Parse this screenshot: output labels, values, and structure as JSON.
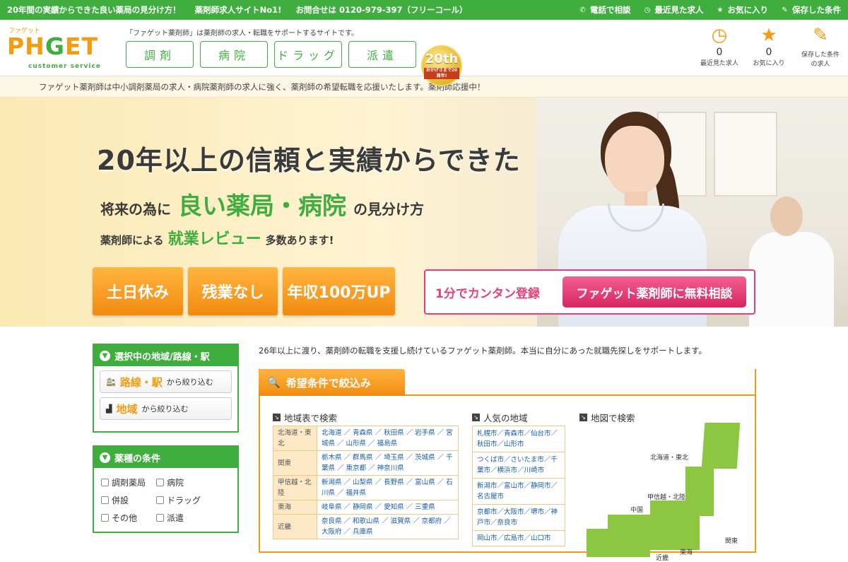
{
  "topbar": {
    "msg1": "20年間の実績からできた良い薬局の見分け方！",
    "msg2": "薬剤師求人サイトNo1!",
    "msg3": "お問合せは 0120-979-397（フリーコール）",
    "links": [
      {
        "icon": "phone-icon",
        "glyph": "✆",
        "label": "電話で相談"
      },
      {
        "icon": "clock-icon",
        "glyph": "◷",
        "label": "最近見た求人"
      },
      {
        "icon": "star-icon",
        "glyph": "★",
        "label": "お気に入り"
      },
      {
        "icon": "edit-icon",
        "glyph": "✎",
        "label": "保存した条件"
      }
    ]
  },
  "header": {
    "logo_kana": "ファゲット",
    "logo_text_1": "PH",
    "logo_text_g": "G",
    "logo_text_2": "ET",
    "logo_sub": "customer service",
    "tagline": "「ファゲット薬剤師」は薬剤師の求人・転職をサポートするサイトです。",
    "nav": [
      "調剤",
      "病院",
      "ドラッグ",
      "派遣"
    ],
    "badge_num": "20th",
    "badge_sub": "おかげさまで20周年!",
    "icons": [
      {
        "name": "recent",
        "glyph": "◷",
        "count": "0",
        "label": "最近見た求人"
      },
      {
        "name": "favorite",
        "glyph": "★",
        "count": "0",
        "label": "お気に入り"
      },
      {
        "name": "saved",
        "glyph": "✎",
        "count": "",
        "label": "保存した条件の求人"
      }
    ]
  },
  "subbar": "ファゲット薬剤師は中小調剤薬局の求人・病院薬剤師の求人に強く、薬剤師の希望転職を応援いたします。薬剤師応援中！",
  "hero": {
    "headline": "20年以上の信頼と実績からできた",
    "line2_pre": "将来の為に",
    "line2_big": "良い薬局・病院",
    "line2_post": "の見分け方",
    "line3_pre": "薬剤師による",
    "line3_big": "就業レビュー",
    "line3_post": "多数あります!",
    "features": [
      "土日休み",
      "残業なし",
      "年収100万UP"
    ],
    "cta_text": "1分でカンタン登録",
    "cta_button": "ファゲット薬剤師に無料相談"
  },
  "sidebar": {
    "area_title": "選択中の地域/路線・駅",
    "route_key": "路線・駅",
    "route_rest": "から絞り込む",
    "area_key": "地域",
    "area_rest": "から絞り込む",
    "type_title": "薬種の条件",
    "types": [
      "調剤薬局",
      "病院",
      "併設",
      "ドラッグ",
      "その他",
      "派遣"
    ]
  },
  "main": {
    "intro": "26年以上に渡り、薬剤師の転職を支援し続けているファゲット薬剤師。本当に自分にあった就職先探しをサポートします。",
    "filter_title": "希望条件で絞込み",
    "region_title": "地域表で検索",
    "popular_title": "人気の地域",
    "map_title": "地図で検索",
    "regions": [
      {
        "region": "北海道・東北",
        "prefs": "北海道 ／ 青森県 ／ 秋田県 ／ 岩手県 ／ 宮城県 ／ 山形県 ／ 福島県"
      },
      {
        "region": "関東",
        "prefs": "栃木県 ／ 群馬県 ／ 埼玉県 ／ 茨城県 ／ 千葉県 ／ 東京都 ／ 神奈川県"
      },
      {
        "region": "甲信越・北陸",
        "prefs": "新潟県 ／ 山梨県 ／ 長野県 ／ 富山県 ／ 石川県 ／ 福井県"
      },
      {
        "region": "東海",
        "prefs": "岐阜県 ／ 静岡県 ／ 愛知県 ／ 三重県"
      },
      {
        "region": "近畿",
        "prefs": "奈良県 ／ 和歌山県 ／ 滋賀県 ／ 京都府 ／ 大阪府 ／ 兵庫県"
      }
    ],
    "popular": [
      "札幌市／青森市／仙台市／秋田市／山形市",
      "つくば市／さいたま市／千葉市／横浜市／川崎市",
      "新潟市／富山市／静岡市／名古屋市",
      "京都市／大阪市／堺市／神戸市／奈良市",
      "岡山市／広島市／山口市"
    ],
    "map_labels": [
      "北海道・東北",
      "甲信越・北陸",
      "中国",
      "関東",
      "東海",
      "近畿"
    ]
  }
}
